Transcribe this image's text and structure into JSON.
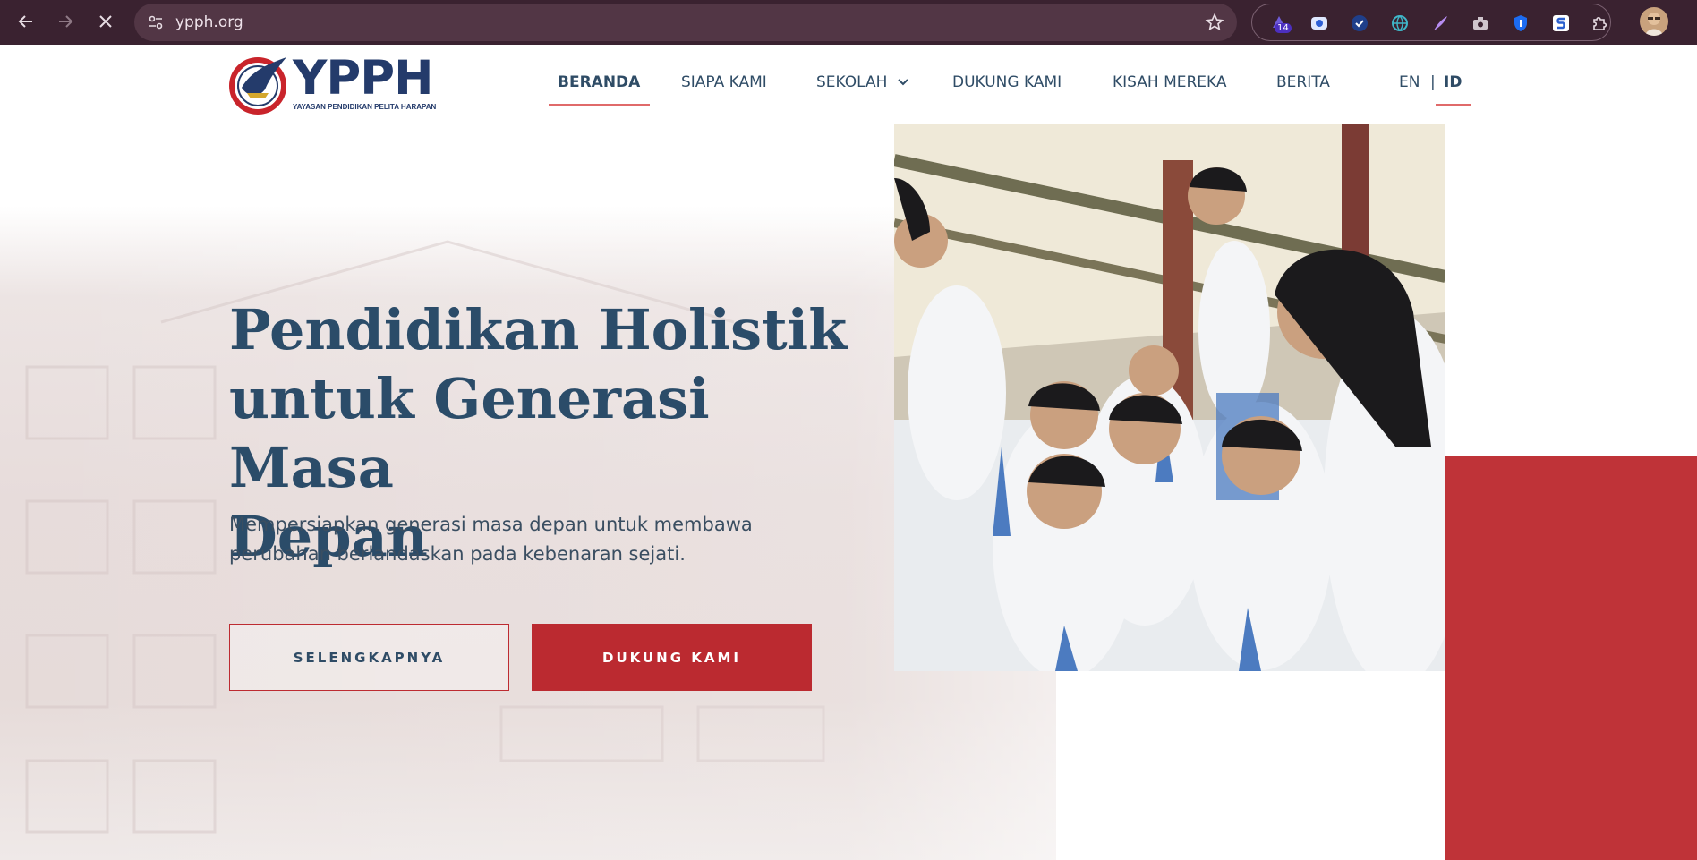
{
  "browser": {
    "url": "ypph.org",
    "extension_badge": "14",
    "icons": [
      "back-arrow-icon",
      "forward-arrow-icon",
      "stop-loading-icon",
      "site-info-icon",
      "bookmark-star-icon",
      "extensions-puzzle-icon",
      "profile-avatar-icon"
    ]
  },
  "site": {
    "logo_text": "YPPH",
    "logo_subtitle": "YAYASAN PENDIDIKAN PELITA HARAPAN",
    "nav": {
      "beranda": "BERANDA",
      "siapa_kami": "SIAPA KAMI",
      "sekolah": "SEKOLAH",
      "dukung_kami": "DUKUNG KAMI",
      "kisah_mereka": "KISAH MEREKA",
      "berita": "BERITA"
    },
    "lang": {
      "en": "EN",
      "separator": "|",
      "id": "ID",
      "active": "ID"
    }
  },
  "hero": {
    "title_line1": "Pendidikan Holistik",
    "title_line2": "untuk Generasi Masa",
    "title_line3": "Depan",
    "subtitle_line1": "Mempersiapkan generasi masa depan untuk membawa",
    "subtitle_line2": "perubahan berlandaskan pada kebenaran sejati.",
    "button_more": "SELENGKAPNYA",
    "button_support": "DUKUNG KAMI"
  },
  "colors": {
    "brand_navy": "#2b4c69",
    "brand_red": "#bb2a30",
    "browser_chrome": "#3a2230",
    "nav_underline": "#e06a6a"
  }
}
